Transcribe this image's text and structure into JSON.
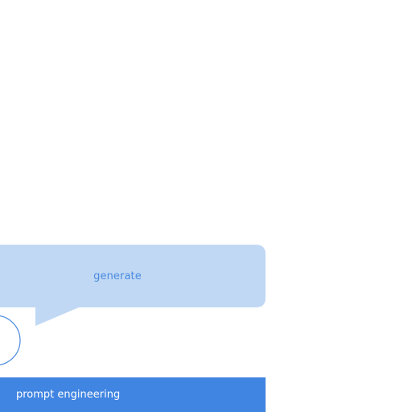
{
  "speech_bubble": {
    "label": "generate",
    "fill_color": "#c0d8f4",
    "text_color": "#4a8be0"
  },
  "avatar": {
    "stroke_color": "#4a8be0"
  },
  "bottom_bar": {
    "label": "prompt engineering",
    "background_color": "#4185e2",
    "text_color": "#ffffff"
  }
}
